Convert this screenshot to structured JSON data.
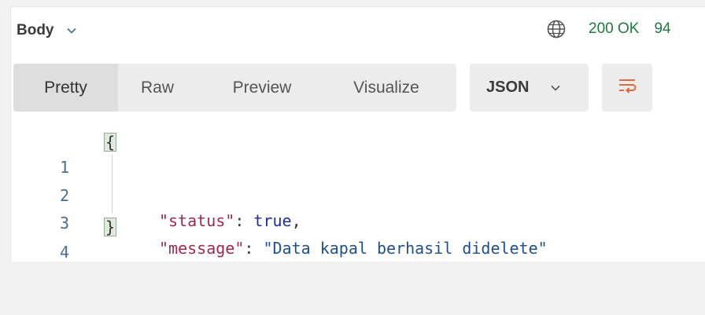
{
  "response": {
    "body_label": "Body",
    "status": "200 OK",
    "size": "94"
  },
  "view_tabs": {
    "pretty": "Pretty",
    "raw": "Raw",
    "preview": "Preview",
    "visualize": "Visualize",
    "active": "Pretty"
  },
  "format": {
    "selected": "JSON"
  },
  "colors": {
    "status_green": "#1f7a3f",
    "wrap_icon": "#e06a3b"
  },
  "code": {
    "line_numbers": [
      "1",
      "2",
      "3",
      "4"
    ],
    "open_brace": "{",
    "close_brace": "}",
    "status_key": "\"status\"",
    "status_value": "true",
    "message_key": "\"message\"",
    "message_value": "\"Data kapal berhasil didelete\""
  }
}
